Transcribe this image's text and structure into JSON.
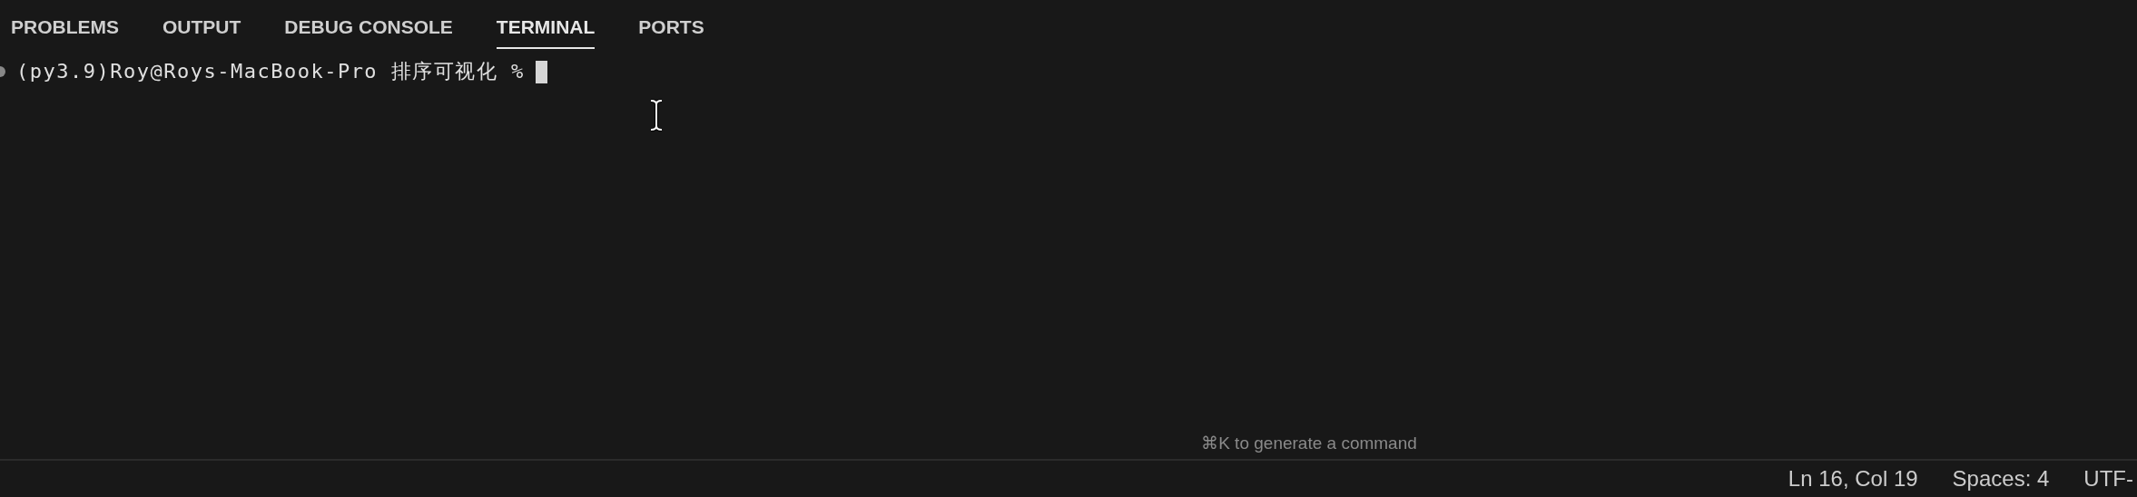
{
  "tabs": [
    {
      "label": "PROBLEMS",
      "selected": false
    },
    {
      "label": "OUTPUT",
      "selected": false
    },
    {
      "label": "DEBUG CONSOLE",
      "selected": false
    },
    {
      "label": "TERMINAL",
      "selected": true
    },
    {
      "label": "PORTS",
      "selected": false
    }
  ],
  "terminal": {
    "prompt": "(py3.9)Roy@Roys-MacBook-Pro 排序可视化 %",
    "hint": "⌘K to generate a command"
  },
  "status_bar": [
    "Ln 16, Col 19",
    "Spaces: 4",
    "UTF-"
  ]
}
